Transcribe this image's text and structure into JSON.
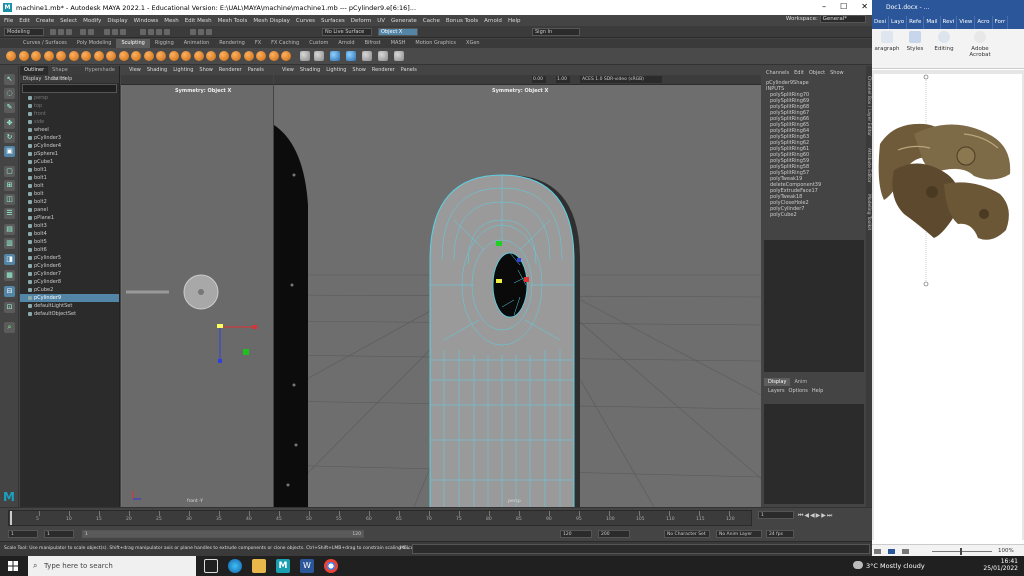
{
  "window": {
    "title": "machine1.mb* - Autodesk MAYA 2022.1 - Educational Version: E:\\UAL\\MAYA\\machine\\machine1.mb  ---  pCylinder9.e[6:16]...",
    "controls": [
      "–",
      "☐",
      "✕"
    ]
  },
  "menubar": [
    "File",
    "Edit",
    "Create",
    "Select",
    "Modify",
    "Display",
    "Windows",
    "Mesh",
    "Edit Mesh",
    "Mesh Tools",
    "Mesh Display",
    "Curves",
    "Surfaces",
    "Deform",
    "UV",
    "Generate",
    "Cache",
    "Bonus Tools",
    "Arnold",
    "Help"
  ],
  "workspace": {
    "label": "Workspace:",
    "value": "General*"
  },
  "statusline": {
    "mode": "Modeling",
    "surface": "No Live Surface",
    "symmetry": "Object X",
    "signin": "Sign In"
  },
  "shelf_tabs": [
    "Curves / Surfaces",
    "Poly Modeling",
    "Sculpting",
    "Rigging",
    "Animation",
    "Rendering",
    "FX",
    "FX Caching",
    "Custom",
    "Arnold",
    "Bifrost",
    "MASH",
    "Motion Graphics",
    "XGen"
  ],
  "shelf_active": "Sculpting",
  "outliner": {
    "tabs": [
      "Outliner",
      "Shape Editor",
      "Hypershade"
    ],
    "menu": [
      "Display",
      "Show",
      "Help"
    ],
    "items": [
      {
        "name": "persp",
        "dim": true
      },
      {
        "name": "top",
        "dim": true
      },
      {
        "name": "front",
        "dim": true
      },
      {
        "name": "side",
        "dim": true
      },
      {
        "name": "wheel",
        "dim": false
      },
      {
        "name": "pCylinder3",
        "dim": false
      },
      {
        "name": "pCylinder4",
        "dim": false
      },
      {
        "name": "pSphere1",
        "dim": false
      },
      {
        "name": "pCube1",
        "dim": false
      },
      {
        "name": "bolt1",
        "dim": false
      },
      {
        "name": "bolt1",
        "dim": false
      },
      {
        "name": "bolt",
        "dim": false
      },
      {
        "name": "bolt",
        "dim": false
      },
      {
        "name": "bolt2",
        "dim": false
      },
      {
        "name": "panel",
        "dim": false
      },
      {
        "name": "pPlane1",
        "dim": false
      },
      {
        "name": "bolt3",
        "dim": false
      },
      {
        "name": "bolt4",
        "dim": false
      },
      {
        "name": "bolt5",
        "dim": false
      },
      {
        "name": "bolt6",
        "dim": false
      },
      {
        "name": "pCylinder5",
        "dim": false
      },
      {
        "name": "pCylinder6",
        "dim": false
      },
      {
        "name": "pCylinder7",
        "dim": false
      },
      {
        "name": "pCylinder8",
        "dim": false
      },
      {
        "name": "pCube2",
        "dim": false
      },
      {
        "name": "pCylinder9",
        "dim": false,
        "selected": true
      },
      {
        "name": "defaultLightSet",
        "dim": false
      },
      {
        "name": "defaultObjectSet",
        "dim": false
      }
    ]
  },
  "viewport_left": {
    "menu": [
      "View",
      "Shading",
      "Lighting",
      "Show",
      "Renderer",
      "Panels"
    ],
    "symmetry_label": "Symmetry: Object X",
    "camera": "front -Y"
  },
  "viewport_right": {
    "menu": [
      "View",
      "Shading",
      "Lighting",
      "Show",
      "Renderer",
      "Panels"
    ],
    "symmetry_label": "Symmetry: Object X",
    "camera": "persp",
    "field_a": "0.00",
    "field_b": "1.00",
    "colorspace": "ACES 1.0 SDR-video (sRGB)"
  },
  "channel_box": {
    "menu": [
      "Channels",
      "Edit",
      "Object",
      "Show"
    ],
    "shape": "pCylinder9Shape",
    "inputs_label": "INPUTS",
    "inputs": [
      "polySplitRing70",
      "polySplitRing69",
      "polySplitRing68",
      "polySplitRing67",
      "polySplitRing66",
      "polySplitRing65",
      "polySplitRing64",
      "polySplitRing63",
      "polySplitRing62",
      "polySplitRing61",
      "polySplitRing60",
      "polySplitRing59",
      "polySplitRing58",
      "polySplitRing57",
      "polyTweak19",
      "deleteComponent39",
      "polyExtrudeFace17",
      "polyTweak18",
      "polyCloseHole2",
      "polyCylinder7",
      "polyCube2"
    ],
    "layer_tabs": [
      "Display",
      "Anim"
    ],
    "layer_menu": [
      "Layers",
      "Options",
      "Help"
    ],
    "side_tabs": [
      "Channel Box / Layer Editor",
      "Attribute Editor",
      "Modeling Toolkit"
    ]
  },
  "timeslider": {
    "ticks": [
      "5",
      "10",
      "15",
      "20",
      "25",
      "30",
      "35",
      "40",
      "45",
      "50",
      "55",
      "60",
      "65",
      "70",
      "75",
      "80",
      "85",
      "90",
      "95",
      "100",
      "105",
      "110",
      "115",
      "120"
    ],
    "current_frame": "1"
  },
  "range": {
    "start": "1",
    "start2": "1",
    "range_inner": "1",
    "range_end": "120",
    "end": "120",
    "end2": "200",
    "character_set": "No Character Set",
    "anim_layer": "No Anim Layer",
    "fps": "24 fps"
  },
  "helpline": {
    "text": "Scale Tool: Use manipulator to scale object(s). Shift+drag manipulator axis or plane handles to extrude components or clone objects. Ctrl+Shift+LMB+drag to constrain scaling to connected edges. Use D or INSERT",
    "mel": "MEL"
  },
  "word": {
    "title": "Doc1.docx - ...",
    "tabs": [
      "Desi",
      "Layo",
      "Refe",
      "Mail",
      "Revi",
      "View",
      "Acro",
      "Forr"
    ],
    "ribbon": [
      {
        "label": "aragraph",
        "icon": "paragraph-icon"
      },
      {
        "label": "Styles",
        "icon": "styles-icon"
      },
      {
        "label": "Editing",
        "icon": "search-icon"
      },
      {
        "label": "Adobe Acrobat",
        "icon": "acrobat-icon"
      }
    ],
    "zoom": "100%"
  },
  "taskbar": {
    "search_placeholder": "Type here to search",
    "weather": "3°C  Mostly cloudy",
    "time": "16:41",
    "date": "25/01/2022"
  },
  "colors": {
    "selection": "#5285a6",
    "wire": "#5ad2e6",
    "word_blue": "#2b579a",
    "viewport_bg": "#6a6a6a"
  }
}
